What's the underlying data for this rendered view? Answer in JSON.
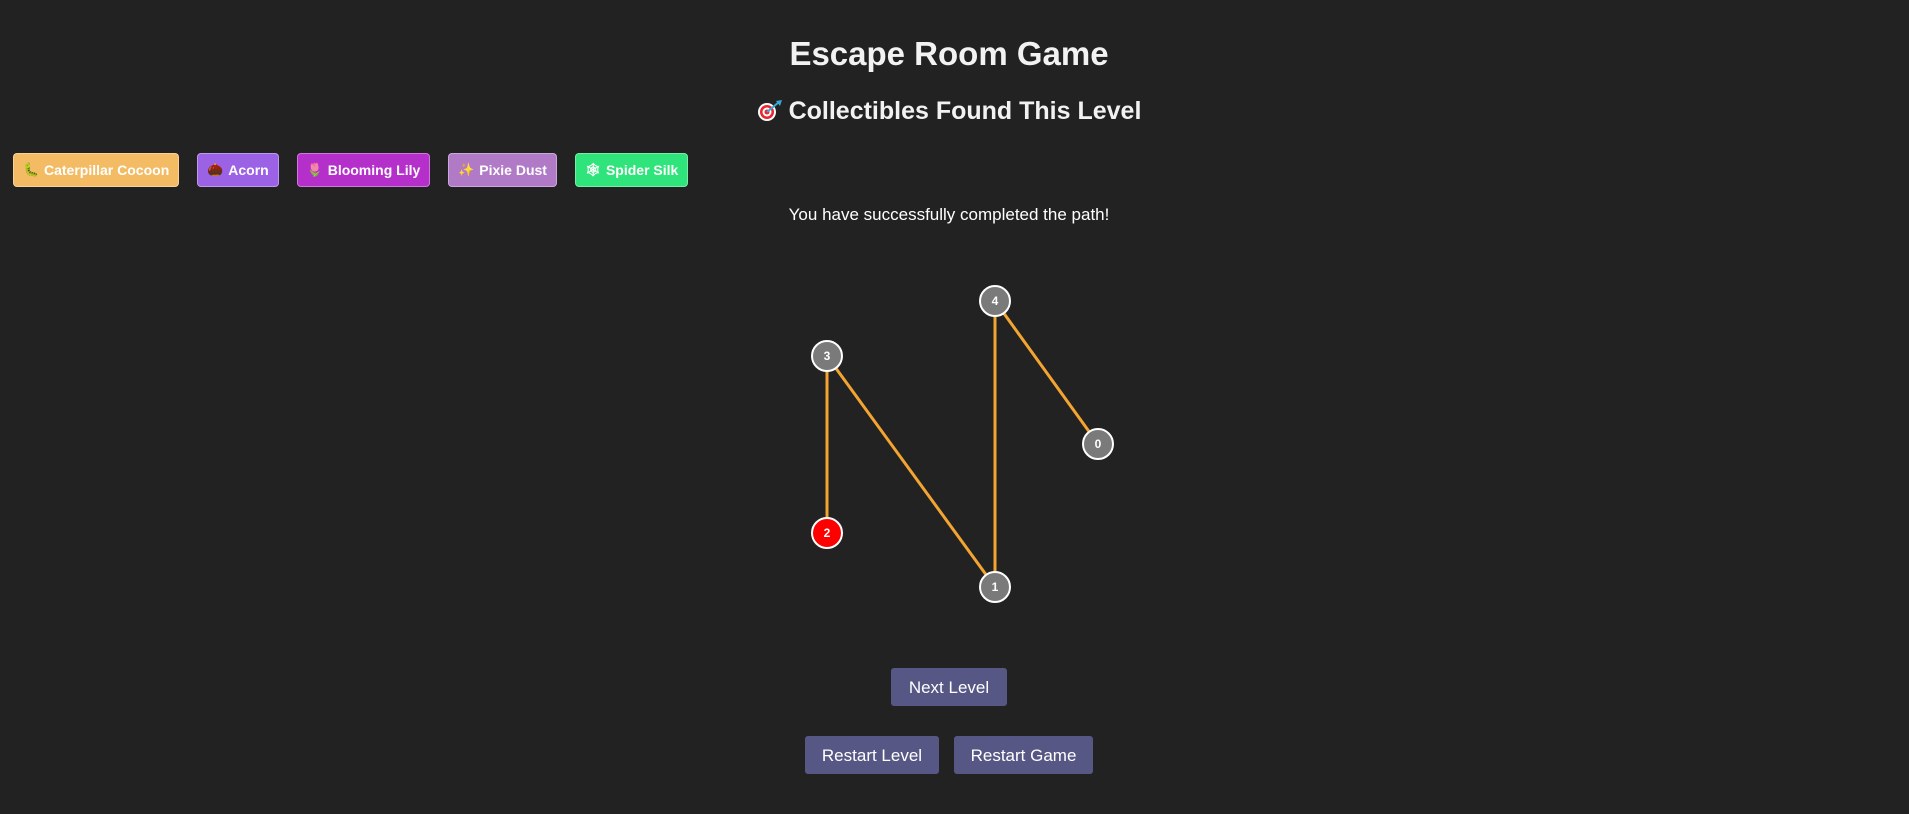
{
  "title": "Escape Room Game",
  "collectibles_heading": "Collectibles Found This Level",
  "collectibles": [
    {
      "label": "Caterpillar Cocoon",
      "icon": "caterpillar-icon",
      "glyph": "🐛",
      "color": "#f3bb63"
    },
    {
      "label": "Acorn",
      "icon": "acorn-icon",
      "glyph": "🌰",
      "color": "#9b62e6"
    },
    {
      "label": "Blooming Lily",
      "icon": "flower-icon",
      "glyph": "🌷",
      "color": "#b52fcb"
    },
    {
      "label": "Pixie Dust",
      "icon": "sparkles-icon",
      "glyph": "✨",
      "color": "#b07ac7"
    },
    {
      "label": "Spider Silk",
      "icon": "web-icon",
      "glyph": "🕸",
      "color": "#2fe47a"
    }
  ],
  "status_message": "You have successfully completed the path!",
  "path": {
    "nodes": [
      {
        "id": "0",
        "state": "visited"
      },
      {
        "id": "1",
        "state": "visited"
      },
      {
        "id": "2",
        "state": "current"
      },
      {
        "id": "3",
        "state": "visited"
      },
      {
        "id": "4",
        "state": "visited"
      }
    ],
    "edges": [
      [
        "0",
        "4"
      ],
      [
        "4",
        "1"
      ],
      [
        "1",
        "3"
      ],
      [
        "3",
        "2"
      ]
    ],
    "colors": {
      "edge": "#f4a431",
      "node_visited": "#7a7a7a",
      "node_current": "#ff0000",
      "node_stroke": "#ffffff"
    }
  },
  "buttons": {
    "next_level": "Next Level",
    "restart_level": "Restart Level",
    "restart_game": "Restart Game"
  },
  "colors": {
    "background": "#222222",
    "button": "#575785"
  }
}
